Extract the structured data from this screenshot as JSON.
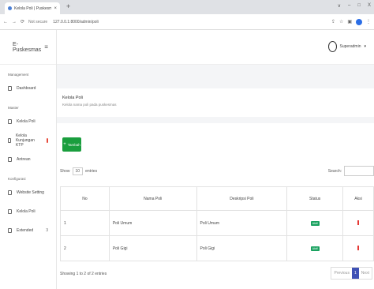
{
  "browser": {
    "tab_title": "Kelola Poli | Puskesmas",
    "tab_close": "×",
    "new_tab": "+",
    "window_controls": [
      "∨",
      "–",
      "□",
      "X"
    ],
    "url_security": "Not secure",
    "url": "127.0.0.1:8000/admin/poli",
    "nav_back": "←",
    "nav_forward": "→",
    "nav_reload": "⟳"
  },
  "sidebar": {
    "brand": "E-Puskesmas",
    "sections": [
      {
        "title": "Management",
        "items": [
          {
            "label": "Dashboard"
          }
        ]
      },
      {
        "title": "Master",
        "items": [
          {
            "label": "Kelola Poli"
          },
          {
            "label": "Kelola Kunjungan KTP"
          },
          {
            "label": "Antrean"
          }
        ]
      },
      {
        "title": "Konfigurasi",
        "items": [
          {
            "label": "Website Setting"
          },
          {
            "label": "Kelola Poli"
          },
          {
            "label": "Extended",
            "count": "3"
          }
        ]
      }
    ]
  },
  "topbar": {
    "user_name": "Superadmin"
  },
  "page": {
    "title": "Kelola Poli",
    "subtitle": "Kelola nama poli pada puskesmas"
  },
  "toolbar": {
    "create_label": "Tambah",
    "create_icon": "+"
  },
  "table_controls": {
    "show_label": "Show",
    "show_value": "10",
    "entries_label": "entries",
    "search_label": "Search:"
  },
  "table": {
    "headers": [
      "No",
      "Nama Poli",
      "Deskripsi Poli",
      "Status",
      "Aksi"
    ],
    "rows": [
      {
        "no": "1",
        "nama": "Poli Umum",
        "deskripsi": "Poli Umum",
        "status": "Aktif"
      },
      {
        "no": "2",
        "nama": "Poli Gigi",
        "deskripsi": "Poli Gigi",
        "status": "Aktif"
      }
    ]
  },
  "footer": {
    "info": "Showing 1 to 2 of 2 entries",
    "prev": "Previous",
    "page": "1",
    "next": "Next"
  }
}
